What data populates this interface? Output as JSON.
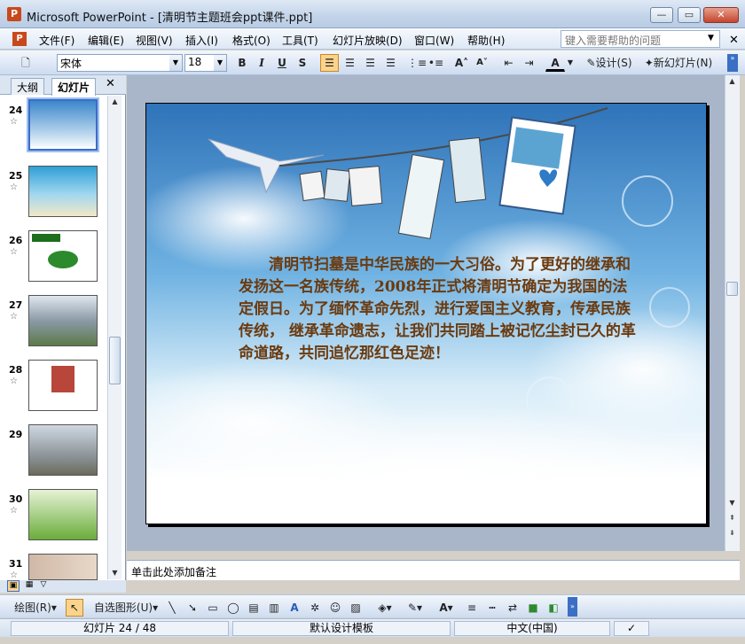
{
  "window": {
    "title": "Microsoft PowerPoint - [清明节主题班会ppt课件.ppt]",
    "app_icon": "P",
    "minimize": "—",
    "restore": "▭",
    "close": "✕"
  },
  "menu": {
    "items": [
      "文件(F)",
      "编辑(E)",
      "视图(V)",
      "插入(I)",
      "格式(O)",
      "工具(T)",
      "幻灯片放映(D)",
      "窗口(W)",
      "帮助(H)"
    ],
    "help_placeholder": "键入需要帮助的问题"
  },
  "format_toolbar": {
    "font": "宋体",
    "size": "18",
    "bold": "B",
    "italic": "I",
    "underline": "U",
    "shadow": "S",
    "font_color": "A",
    "design": "设计(S)",
    "new_slide": "新幻灯片(N)"
  },
  "left_pane": {
    "tabs": [
      "大纲",
      "幻灯片"
    ],
    "active_tab": "幻灯片",
    "thumbnails": [
      {
        "num": "24",
        "selected": true
      },
      {
        "num": "25",
        "selected": false
      },
      {
        "num": "26",
        "selected": false
      },
      {
        "num": "27",
        "selected": false
      },
      {
        "num": "28",
        "selected": false
      },
      {
        "num": "29",
        "selected": false
      },
      {
        "num": "30",
        "selected": false
      },
      {
        "num": "31",
        "selected": false
      }
    ]
  },
  "slide": {
    "body_text": "清明节扫墓是中华民族的一大习俗。为了更好的继承和发扬这一名族传统，2008年正式将清明节确定为我国的法定假日。为了缅怀革命先烈，进行爱国主义教育，传承民族传统， 继承革命遗志，让我们共同踏上被记忆尘封已久的革命道路，共同追忆那红色足迹！",
    "photo_caption": "love."
  },
  "notes": {
    "placeholder": "单击此处添加备注"
  },
  "drawing_toolbar": {
    "draw": "绘图(R)",
    "autoshapes": "自选图形(U)"
  },
  "status": {
    "slide": "幻灯片 24 / 48",
    "template": "默认设计模板",
    "language": "中文(中国)"
  },
  "colors": {
    "slide_text": "#6b3a0e",
    "sky": "#3f8cd0",
    "selection": "#3b6cc8"
  }
}
